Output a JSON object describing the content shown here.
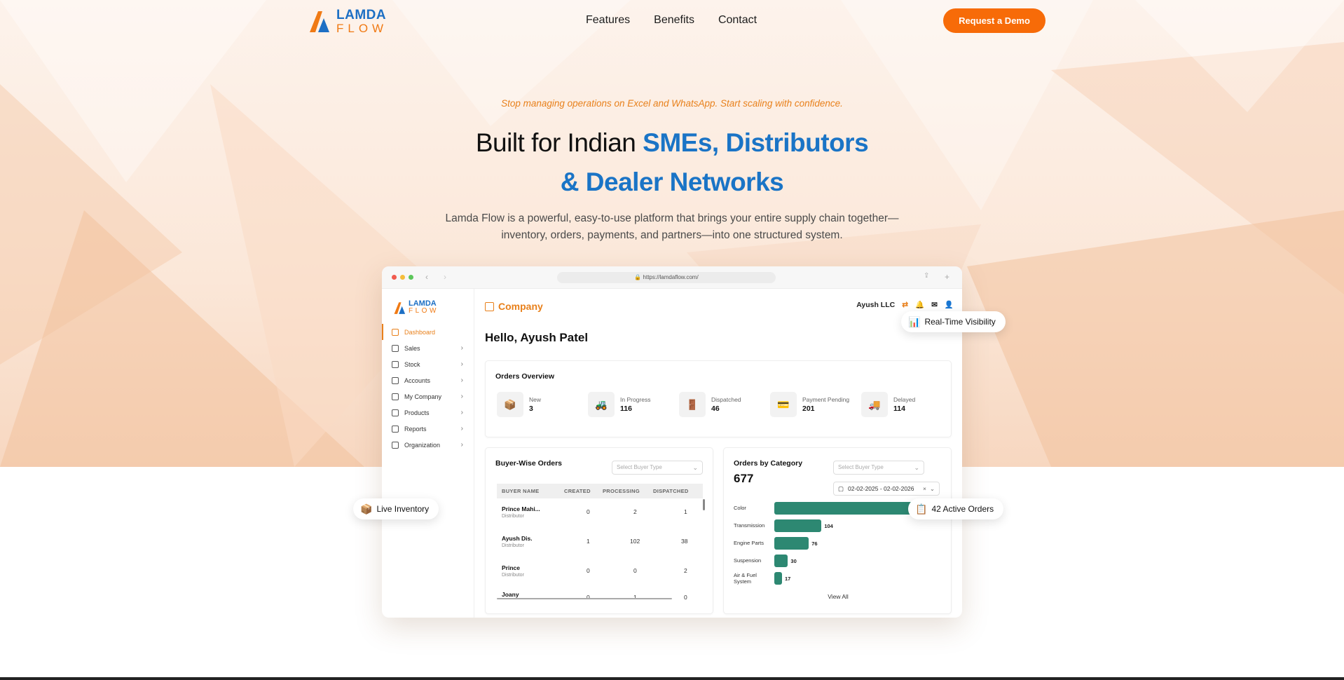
{
  "brand": {
    "logo_top": "LAMDA",
    "logo_bottom": "FLOW"
  },
  "nav": {
    "items": [
      "Features",
      "Benefits",
      "Contact"
    ],
    "cta": "Request a Demo"
  },
  "hero": {
    "tagline": "Stop managing operations on Excel and WhatsApp. Start scaling with confidence.",
    "headline_plain": "Built for Indian ",
    "headline_accent_1": "SMEs, Distributors",
    "headline_accent_2": "& Dealer Networks",
    "description": "Lamda Flow is a powerful, easy-to-use platform that brings your entire supply chain together—inventory, orders, payments, and partners—into one structured system."
  },
  "colors": {
    "accent_orange": "#f76b08",
    "accent_blue": "#1a74c6",
    "bar_green": "#2d8872"
  },
  "browser": {
    "url": "https://lamdaflow.com/"
  },
  "app": {
    "sidebar": {
      "logo_top": "LAMDA",
      "logo_bottom": "FLOW",
      "items": [
        "Dashboard",
        "Sales",
        "Stock",
        "Accounts",
        "My Company",
        "Products",
        "Reports",
        "Organization"
      ]
    },
    "header": {
      "section": "Company",
      "org_name": "Ayush LLC",
      "icons": [
        "shuffle-icon",
        "bell-icon",
        "mail-icon",
        "avatar-icon"
      ]
    },
    "greeting": "Hello, Ayush Patel",
    "orders_overview": {
      "title": "Orders Overview",
      "stats": [
        {
          "label": "New",
          "value": "3",
          "icon": "new-order-icon"
        },
        {
          "label": "In Progress",
          "value": "116",
          "icon": "in-progress-icon"
        },
        {
          "label": "Dispatched",
          "value": "46",
          "icon": "dispatched-icon"
        },
        {
          "label": "Payment Pending",
          "value": "201",
          "icon": "payment-pending-icon"
        },
        {
          "label": "Delayed",
          "value": "114",
          "icon": "delayed-icon"
        }
      ]
    },
    "buyer_orders": {
      "title": "Buyer-Wise Orders",
      "select_placeholder": "Select Buyer Type",
      "columns": [
        "BUYER NAME",
        "CREATED",
        "PROCESSING",
        "DISPATCHED"
      ],
      "rows": [
        {
          "name": "Prince Mahi...",
          "type": "Distributor",
          "created": "0",
          "processing": "2",
          "dispatched": "1"
        },
        {
          "name": "Ayush Dis.",
          "type": "Distributor",
          "created": "1",
          "processing": "102",
          "dispatched": "38"
        },
        {
          "name": "Prince",
          "type": "Distributor",
          "created": "0",
          "processing": "0",
          "dispatched": "2"
        },
        {
          "name": "Joany",
          "type": "",
          "created": "0",
          "processing": "1",
          "dispatched": "0"
        }
      ]
    },
    "orders_by_category": {
      "title": "Orders by Category",
      "total": "677",
      "select_placeholder": "Select Buyer Type",
      "date_range": "02-02-2025 - 02-02-2026",
      "view_all": "View All"
    }
  },
  "chart_data": {
    "type": "bar",
    "orientation": "horizontal",
    "categories": [
      "Color",
      "Transmission",
      "Engine Parts",
      "Suspension",
      "Air & Fuel System"
    ],
    "values": [
      null,
      104,
      76,
      30,
      17
    ],
    "xlim": [
      0,
      380
    ]
  },
  "floating_badges": {
    "realtime": "Real-Time Visibility",
    "inventory": "Live Inventory",
    "active_orders": "42 Active Orders"
  }
}
